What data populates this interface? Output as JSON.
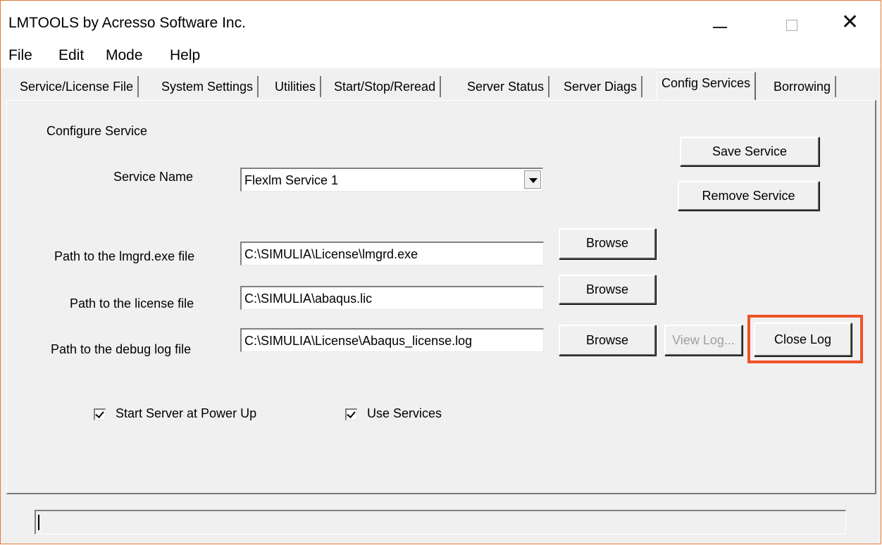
{
  "window": {
    "title": "LMTOOLS by Acresso Software Inc."
  },
  "menu": [
    "File",
    "Edit",
    "Mode",
    "Help"
  ],
  "tabs": [
    "Service/License File",
    "System Settings",
    "Utilities",
    "Start/Stop/Reread",
    "Server Status",
    "Server Diags",
    "Config Services",
    "Borrowing"
  ],
  "active_tab": "Config Services",
  "config": {
    "section_label": "Configure Service",
    "service_name_label": "Service Name",
    "service_name_value": "Flexlm Service 1",
    "lmgrd_label": "Path to the lmgrd.exe file",
    "lmgrd_value": "C:\\SIMULIA\\License\\lmgrd.exe",
    "license_label": "Path to the license file",
    "license_value": "C:\\SIMULIA\\abaqus.lic",
    "debug_label": "Path to the debug log file",
    "debug_value": "C:\\SIMULIA\\License\\Abaqus_license.log",
    "browse_label": "Browse",
    "save_service_label": "Save Service",
    "remove_service_label": "Remove Service",
    "view_log_label": "View Log...",
    "close_log_label": "Close Log",
    "start_server_label": "Start Server at Power Up",
    "start_server_checked": true,
    "use_services_label": "Use Services",
    "use_services_checked": true
  },
  "colors": {
    "highlight": "#f0522a",
    "window_border": "#e07b39"
  },
  "status": {
    "text": ""
  }
}
